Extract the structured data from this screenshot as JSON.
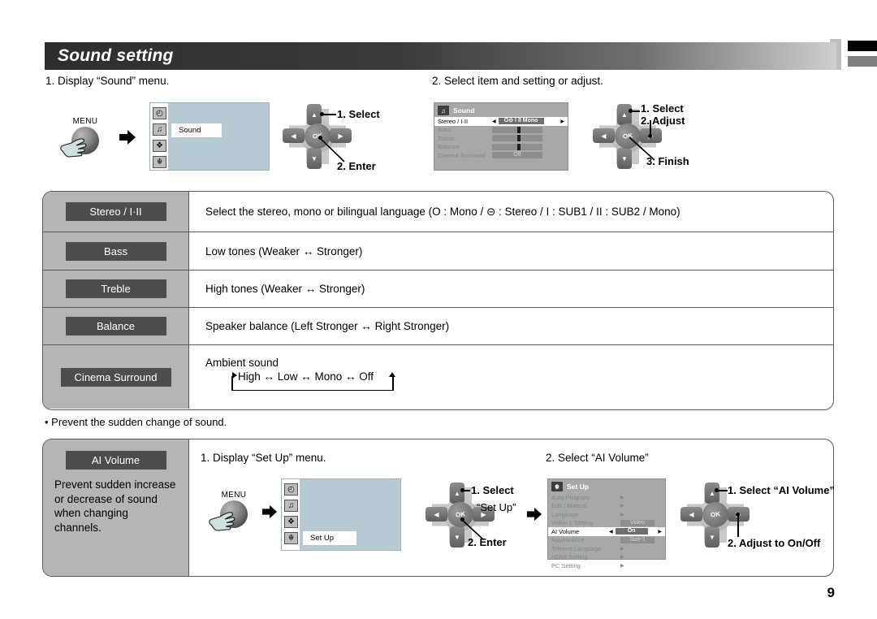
{
  "page": {
    "title": "Sound setting",
    "number": "9"
  },
  "section1": {
    "step1_header": "1. Display “Sound” menu.",
    "step2_header": "2. Select item and setting or adjust.",
    "menu_button_label": "MENU",
    "tv_menu": {
      "selected_tooltip": "Sound",
      "icons": [
        "picture-icon",
        "sound-icon",
        "timer-icon",
        "setup-icon"
      ]
    },
    "dpad1": {
      "ok_label": "OK",
      "callouts": [
        "1. Select",
        "2. Enter"
      ]
    },
    "osd_sound": {
      "title": "Sound",
      "rows": [
        {
          "name": "Stereo / I·II",
          "value": "O⊝ I II Mono",
          "type": "select",
          "highlighted": true
        },
        {
          "name": "Bass",
          "value": "",
          "type": "bar",
          "highlighted": false
        },
        {
          "name": "Treble",
          "value": "",
          "type": "bar",
          "highlighted": false
        },
        {
          "name": "Balance",
          "value": "",
          "type": "bar",
          "highlighted": false
        },
        {
          "name": "Cinema Surround",
          "value": "Off",
          "type": "value",
          "highlighted": false
        }
      ]
    },
    "dpad2": {
      "ok_label": "OK",
      "callouts": [
        "1. Select",
        "2. Adjust",
        "3. Finish"
      ]
    }
  },
  "table": {
    "rows": [
      {
        "label": "Stereo / I·II",
        "description": "Select the stereo, mono or bilingual language (O : Mono / ⊝ : Stereo / I : SUB1 / II : SUB2 / Mono)"
      },
      {
        "label": "Bass",
        "description": "Low tones (Weaker ↔ Stronger)"
      },
      {
        "label": "Treble",
        "description": "High tones (Weaker ↔ Stronger)"
      },
      {
        "label": "Balance",
        "description": "Speaker balance (Left Stronger ↔ Right Stronger)"
      },
      {
        "label": "Cinema Surround",
        "description": "Ambient sound",
        "cycle": "High ↔ Low ↔ Mono ↔ Off"
      }
    ]
  },
  "note": "• Prevent the sudden change of sound.",
  "section2": {
    "label_chip": "AI Volume",
    "description": "Prevent sudden increase or decrease of sound when changing channels.",
    "step1_header": "1. Display “Set Up” menu.",
    "step2_header": "2. Select “AI Volume”",
    "menu_button_label": "MENU",
    "tv_menu": {
      "selected_tooltip": "Set Up",
      "icons": [
        "picture-icon",
        "sound-icon",
        "timer-icon",
        "setup-icon"
      ]
    },
    "dpad1": {
      "ok_label": "OK",
      "callouts": [
        "1. Select",
        "“Set Up”",
        "2. Enter"
      ]
    },
    "osd_setup": {
      "title": "Set Up",
      "rows": [
        {
          "name": "Auto Program",
          "value": "",
          "type": "submenu",
          "highlighted": false
        },
        {
          "name": "Edit / Manual",
          "value": "",
          "type": "submenu",
          "highlighted": false
        },
        {
          "name": "Language",
          "value": "",
          "type": "submenu",
          "highlighted": false
        },
        {
          "name": "Video-1 Setting",
          "value": "Video",
          "type": "value",
          "highlighted": false
        },
        {
          "name": "AI Volume",
          "value": "On",
          "type": "select",
          "highlighted": true
        },
        {
          "name": "Appearance",
          "value": "Size-1",
          "type": "value",
          "highlighted": false
        },
        {
          "name": "Teletext Language",
          "value": "",
          "type": "submenu",
          "highlighted": false
        },
        {
          "name": "HDMI Setting",
          "value": "",
          "type": "submenu",
          "highlighted": false
        },
        {
          "name": "PC Setting",
          "value": "",
          "type": "submenu",
          "highlighted": false
        }
      ]
    },
    "dpad2": {
      "ok_label": "OK",
      "callouts": [
        "1. Select “AI Volume”",
        "2. Adjust to On/Off"
      ]
    }
  },
  "colors": {
    "title_bar_dark": "#2e2e2e",
    "chip_bg": "#4d4d4d",
    "label_col_bg": "#b5b5b5",
    "tv_screen_blue": "#b7c9d3",
    "osd_bg": "#a8a8a8"
  }
}
